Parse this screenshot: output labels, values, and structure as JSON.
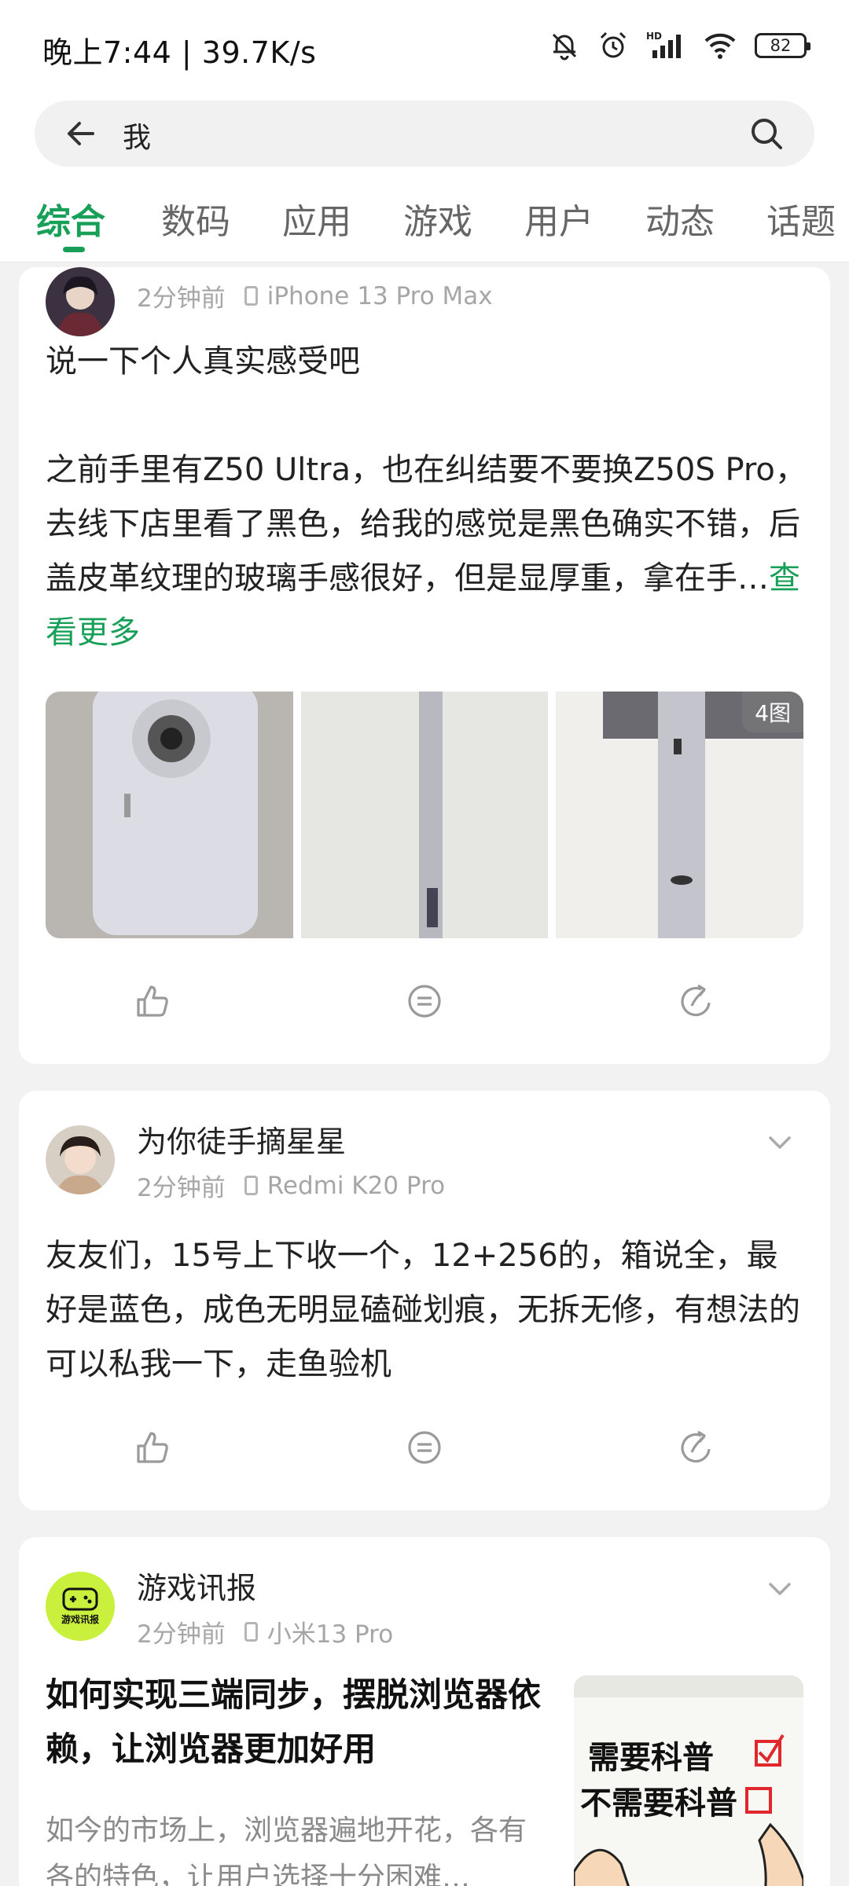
{
  "status_bar": {
    "time_speed": "晚上7:44 | 39.7K/s",
    "hd_label": "HD",
    "battery": "82"
  },
  "search": {
    "query": "我"
  },
  "tabs": [
    {
      "label": "综合",
      "active": true
    },
    {
      "label": "数码",
      "active": false
    },
    {
      "label": "应用",
      "active": false
    },
    {
      "label": "游戏",
      "active": false
    },
    {
      "label": "用户",
      "active": false
    },
    {
      "label": "动态",
      "active": false
    },
    {
      "label": "话题",
      "active": false
    }
  ],
  "posts": [
    {
      "time": "2分钟前",
      "device": "iPhone 13 Pro Max",
      "text": "说一下个人真实感受吧\n\n之前手里有Z50 Ultra，也在纠结要不要换Z50S Pro，去线下店里看了黑色，给我的感觉是黑色确实不错，后盖皮革纹理的玻璃手感很好，但是显厚重，拿在手…",
      "see_more": "查看更多",
      "image_count": "4图"
    },
    {
      "username": "为你徒手摘星星",
      "time": "2分钟前",
      "device": "Redmi K20 Pro",
      "text": "友友们，15号上下收一个，12+256的，箱说全，最好是蓝色，成色无明显磕碰划痕，无拆无修，有想法的可以私我一下，走鱼验机"
    },
    {
      "username": "游戏讯报",
      "avatar_text": "游戏讯报",
      "time": "2分钟前",
      "device": "小米13 Pro",
      "title": "如何实现三端同步，摆脱浏览器依赖，让浏览器更加好用",
      "summary": "如今的市场上，浏览器遍地开花，各有各的特色，让用户选择十分困难…",
      "thumb_line1": "需要科普",
      "thumb_line2": "不需要科普"
    }
  ],
  "colors": {
    "accent": "#18a058",
    "background": "#f2f2f2"
  }
}
